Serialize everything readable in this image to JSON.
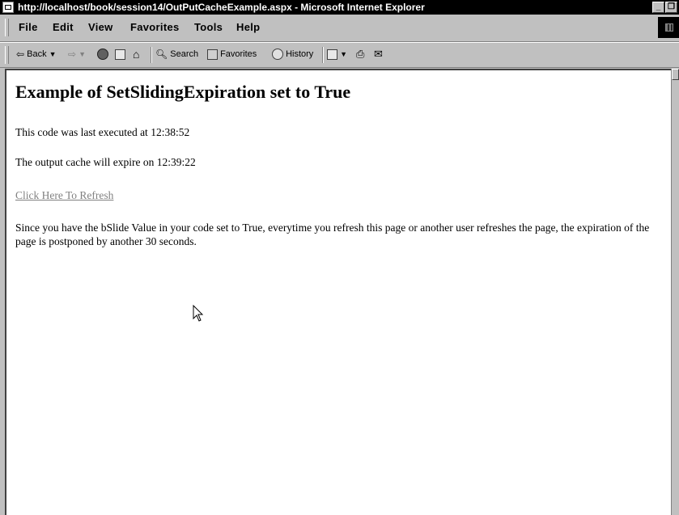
{
  "window": {
    "title": "http://localhost/book/session14/OutPutCacheExample.aspx - Microsoft Internet Explorer",
    "minimize_label": "_",
    "restore_label": "❐"
  },
  "menu": {
    "items": [
      "File",
      "Edit",
      "View",
      "Favorites",
      "Tools",
      "Help"
    ]
  },
  "toolbar": {
    "back_label": "Back",
    "search_label": "Search",
    "favorites_label": "Favorites",
    "history_label": "History"
  },
  "page": {
    "heading": "Example of SetSlidingExpiration set to True",
    "executed_text": "This code was last executed at 12:38:52",
    "expire_text": "The output cache will expire on 12:39:22",
    "refresh_link": "Click Here To Refresh",
    "explanation": "Since you have the bSlide Value in your code set to True, everytime you refresh this page or another user refreshes the page, the expiration of the page is postponed by another 30 seconds."
  },
  "icons": {
    "back": "left-arrow-icon",
    "forward": "right-arrow-icon",
    "stop": "stop-icon",
    "refresh": "refresh-icon",
    "home": "home-icon",
    "search": "search-icon",
    "favorites": "favorites-icon",
    "history": "history-icon",
    "edit": "edit-page-icon",
    "print": "print-icon",
    "mail": "mail-icon"
  }
}
